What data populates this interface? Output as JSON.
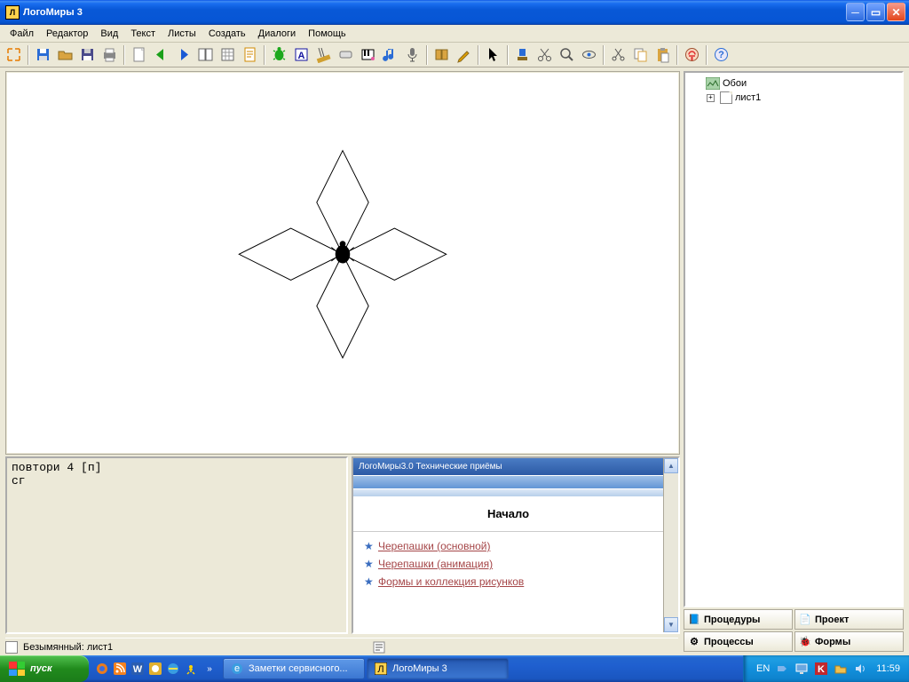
{
  "window": {
    "title": "ЛогоМиры 3"
  },
  "menu": [
    "Файл",
    "Редактор",
    "Вид",
    "Текст",
    "Листы",
    "Создать",
    "Диалоги",
    "Помощь"
  ],
  "toolbar_groups": [
    [
      {
        "n": "expand",
        "c": "#e77b00"
      }
    ],
    [
      {
        "n": "disk-blue",
        "c": "#2a6cd5"
      },
      {
        "n": "open",
        "c": "#d9a441"
      },
      {
        "n": "save",
        "c": "#333"
      },
      {
        "n": "print",
        "c": "#555"
      }
    ],
    [
      {
        "n": "new-page",
        "c": "#888"
      },
      {
        "n": "arrow-left",
        "c": "#1aa01a"
      },
      {
        "n": "arrow-right",
        "c": "#1a5ad5"
      },
      {
        "n": "dual",
        "c": "#555"
      },
      {
        "n": "grid",
        "c": "#555"
      },
      {
        "n": "sheet",
        "c": "#d08a00"
      }
    ],
    [
      {
        "n": "turtle",
        "c": "#1ca81c"
      },
      {
        "n": "text-tool",
        "c": "#14149f"
      },
      {
        "n": "ruler",
        "c": "#d0a030"
      },
      {
        "n": "button",
        "c": "#777"
      },
      {
        "n": "music",
        "c": "#e85aa3"
      },
      {
        "n": "note",
        "c": "#2a6cd5"
      },
      {
        "n": "mic",
        "c": "#555"
      }
    ],
    [
      {
        "n": "book",
        "c": "#d9a441"
      },
      {
        "n": "pencil",
        "c": "#e0a000"
      }
    ],
    [
      {
        "n": "pointer",
        "c": "#000"
      }
    ],
    [
      {
        "n": "stamp",
        "c": "#2a6cd5"
      },
      {
        "n": "scissors",
        "c": "#555"
      },
      {
        "n": "lens",
        "c": "#555"
      },
      {
        "n": "eye",
        "c": "#555"
      }
    ],
    [
      {
        "n": "cut",
        "c": "#555"
      },
      {
        "n": "copy",
        "c": "#d9a441"
      },
      {
        "n": "paste",
        "c": "#d9a441"
      }
    ],
    [
      {
        "n": "stop",
        "c": "#e03030"
      }
    ],
    [
      {
        "n": "help",
        "c": "#2a6cd5"
      }
    ]
  ],
  "tree": {
    "root": "Обои",
    "child": "лист1"
  },
  "right_buttons": [
    {
      "label": "Процедуры",
      "icon": "📘"
    },
    {
      "label": "Проект",
      "icon": "📄"
    },
    {
      "label": "Процессы",
      "icon": "⚙"
    },
    {
      "label": "Формы",
      "icon": "🐞"
    }
  ],
  "command_lines": [
    "повтори 4 [п]",
    "сг"
  ],
  "help": {
    "header": "ЛогоМиры3.0 Технические приёмы",
    "section": "Начало",
    "links": [
      "Черепашки (основной)",
      "Черепашки (анимация)",
      "Формы и коллекция рисунков"
    ]
  },
  "status": "Безымянный: лист1",
  "taskbar": {
    "start": "пуск",
    "tasks": [
      {
        "label": "Заметки сервисного...",
        "active": false
      },
      {
        "label": "ЛогоМиры 3",
        "active": true
      }
    ],
    "lang": "EN",
    "clock": "11:59"
  }
}
